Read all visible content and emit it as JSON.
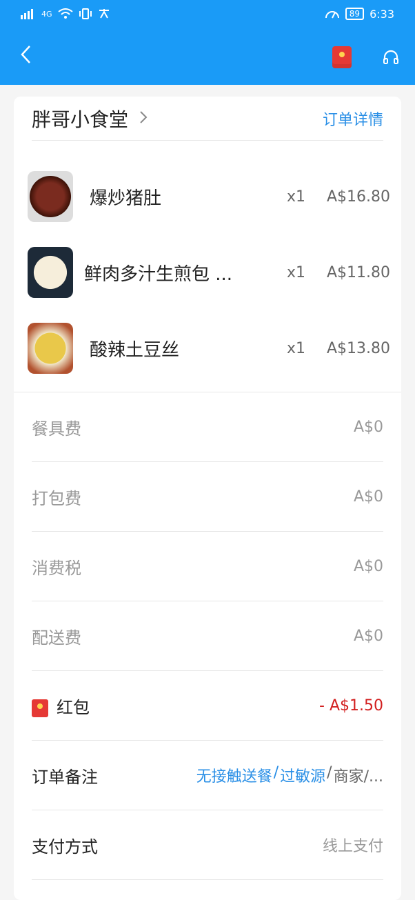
{
  "statusbar": {
    "network": "4G",
    "battery": "89",
    "time": "6:33"
  },
  "nav": {
    "back_icon": "chevron-left-icon",
    "redpacket_icon": "red-packet-icon",
    "support_icon": "headset-icon"
  },
  "store": {
    "name": "胖哥小食堂",
    "detail_link": "订单详情"
  },
  "items": [
    {
      "name": "爆炒猪肚",
      "qty": "x1",
      "price": "A$16.80"
    },
    {
      "name": "鲜肉多汁生煎包 ...",
      "qty": "x1",
      "price": "A$11.80"
    },
    {
      "name": "酸辣土豆丝",
      "qty": "x1",
      "price": "A$13.80"
    }
  ],
  "fees": [
    {
      "label": "餐具费",
      "value": "A$0"
    },
    {
      "label": "打包费",
      "value": "A$0"
    },
    {
      "label": "消费税",
      "value": "A$0"
    },
    {
      "label": "配送费",
      "value": "A$0"
    }
  ],
  "redpacket": {
    "label": "红包",
    "value": "- A$1.50"
  },
  "remarks": {
    "label": "订单备注",
    "part1": "无接触送餐",
    "sep1": "/",
    "part2": "过敏源",
    "sep2": "/",
    "part3": "商家/..."
  },
  "payment": {
    "label": "支付方式",
    "value": "线上支付"
  },
  "colors": {
    "primary": "#1a9bf7",
    "accent_blue": "#2a8fe6",
    "discount_red": "#d21e1e"
  }
}
